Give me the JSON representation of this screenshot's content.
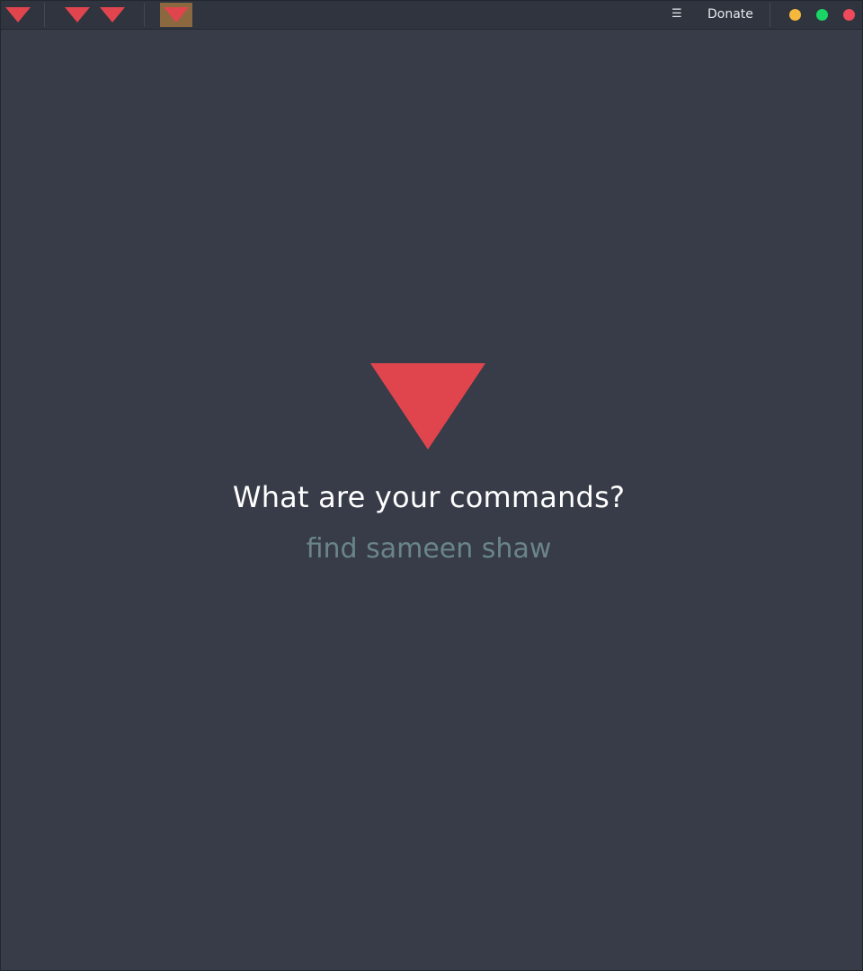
{
  "titlebar": {
    "menu_icon": "☰",
    "donate_label": "Donate",
    "window_controls": {
      "minimize_color": "#f5b83d",
      "maximize_color": "#1ad466",
      "close_color": "#ef4a5c"
    },
    "app_icon": "red-inverted-triangle-icon",
    "active_tab_color": "#8c6840"
  },
  "main": {
    "logo_icon": "red-inverted-triangle-icon",
    "logo_color": "#e0454e",
    "prompt": "What are your commands?",
    "command_value": "find sameen shaw"
  }
}
